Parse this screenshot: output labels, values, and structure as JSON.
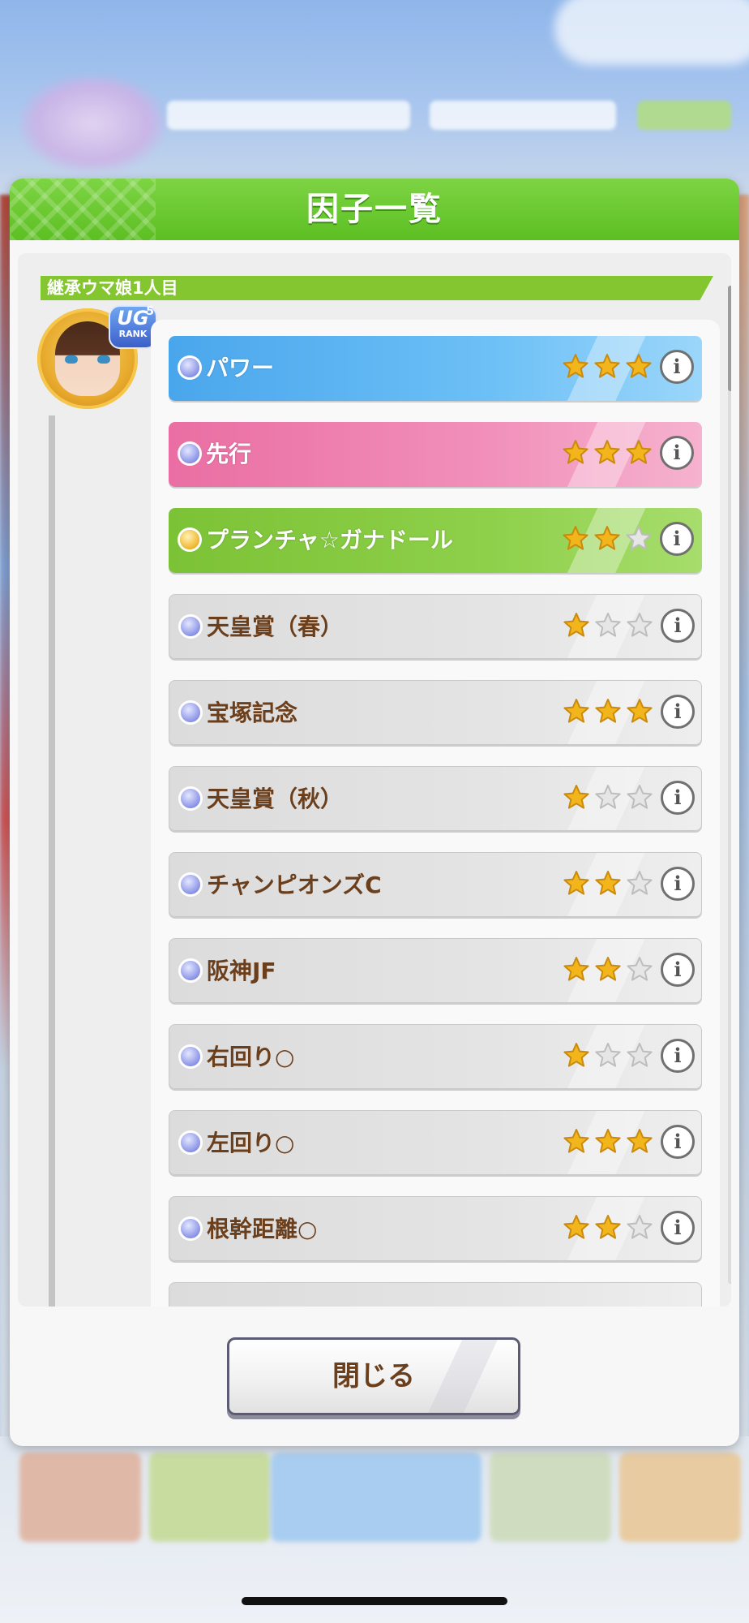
{
  "dialog": {
    "title": "因子一覧",
    "section_label": "継承ウマ娘1人目",
    "rank_badge": {
      "text": "UG",
      "sub": "RANK",
      "level": "5"
    },
    "close_label": "閉じる"
  },
  "colors": {
    "header_green": "#5cbf22",
    "blue_factor": "#4aa6ec",
    "pink_factor": "#ea6ea3",
    "green_factor": "#7cc236",
    "gray_factor": "#dcdcdc",
    "gray_text": "#6b3f1c",
    "star_gold": "#f2b51b"
  },
  "factors": [
    {
      "name": "パワー",
      "stars": 3,
      "type": "blue",
      "orb": "blue-orb"
    },
    {
      "name": "先行",
      "stars": 3,
      "type": "pink",
      "orb": "blue-orb"
    },
    {
      "name": "プランチャ☆ガナドール",
      "stars": 2,
      "type": "green",
      "orb": "gold-orb"
    },
    {
      "name": "天皇賞（春）",
      "stars": 1,
      "type": "gray",
      "orb": "blue-orb"
    },
    {
      "name": "宝塚記念",
      "stars": 3,
      "type": "gray",
      "orb": "blue-orb"
    },
    {
      "name": "天皇賞（秋）",
      "stars": 1,
      "type": "gray",
      "orb": "blue-orb"
    },
    {
      "name": "チャンピオンズC",
      "stars": 2,
      "type": "gray",
      "orb": "blue-orb"
    },
    {
      "name": "阪神JF",
      "stars": 2,
      "type": "gray",
      "orb": "blue-orb"
    },
    {
      "name": "右回り○",
      "stars": 1,
      "type": "gray",
      "orb": "blue-orb"
    },
    {
      "name": "左回り○",
      "stars": 3,
      "type": "gray",
      "orb": "blue-orb"
    },
    {
      "name": "根幹距離○",
      "stars": 2,
      "type": "gray",
      "orb": "blue-orb"
    }
  ],
  "icons": {
    "factor_orb": "orb-icon",
    "star": "star-icon",
    "info": "info-icon"
  }
}
